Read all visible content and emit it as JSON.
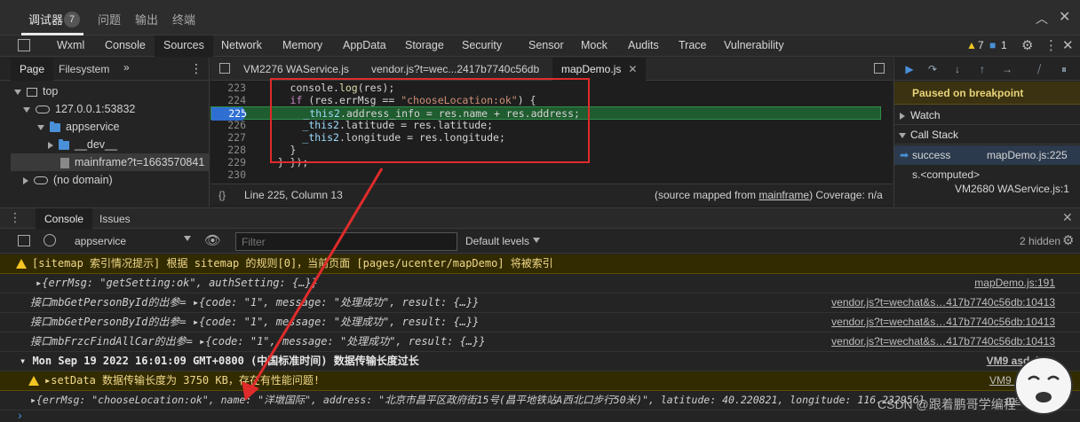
{
  "top_tabs": [
    {
      "label": "调试器",
      "active": true
    },
    {
      "label": "问题"
    },
    {
      "label": "输出"
    },
    {
      "label": "终端"
    }
  ],
  "top_badge": "7",
  "devtools_tabs": [
    "Wxml",
    "Console",
    "Sources",
    "Network",
    "Memory",
    "AppData",
    "Storage",
    "Security",
    "Sensor",
    "Mock",
    "Audits",
    "Trace",
    "Vulnerability"
  ],
  "devtools_active": "Sources",
  "warn_count": "7",
  "info_count": "1",
  "navigator": {
    "tabs": [
      "Page",
      "Filesystem"
    ],
    "more": "»",
    "tree": [
      "top",
      "127.0.0.1:53832",
      "appservice",
      "__dev__",
      "mainframe?t=1663570841",
      "(no domain)"
    ]
  },
  "editor": {
    "tabs": [
      "VM2276 WAService.js",
      "vendor.js?t=wec...2417b7740c56db",
      "mapDemo.js"
    ],
    "lines": [
      {
        "num": "223",
        "text": "      console.log(res);"
      },
      {
        "num": "224",
        "text": "      if (res.errMsg == \"chooseLocation:ok\") {"
      },
      {
        "num": "225",
        "text": "        _this2.address_info = res.name + res.address;"
      },
      {
        "num": "226",
        "text": "        _this2.latitude = res.latitude;"
      },
      {
        "num": "227",
        "text": "        _this2.longitude = res.longitude;"
      },
      {
        "num": "228",
        "text": "      }"
      },
      {
        "num": "229",
        "text": "    } });"
      },
      {
        "num": "230",
        "text": ""
      }
    ],
    "status_pos": "Line 225, Column 13",
    "status_mapped_prefix": "(source mapped from ",
    "status_mapped_link": "mainframe",
    "status_mapped_suffix": ") Coverage: n/a"
  },
  "debugger": {
    "paused": "Paused on breakpoint",
    "watch": "Watch",
    "call_stack": "Call Stack",
    "stack": [
      {
        "fn": "success",
        "loc": "mapDemo.js:225"
      },
      {
        "fn": "s.<computed>",
        "loc": ""
      },
      {
        "fn": "",
        "loc": "VM2680 WAService.js:1"
      }
    ]
  },
  "console": {
    "tabs": [
      "Console",
      "Issues"
    ],
    "context": "appservice",
    "filter_placeholder": "Filter",
    "levels": "Default levels",
    "hidden": "2 hidden",
    "messages": [
      {
        "type": "warn",
        "text": "[sitemap 索引情况提示] 根据 sitemap 的规则[0]，当前页面 [pages/ucenter/mapDemo] 将被索引",
        "src": ""
      },
      {
        "type": "log",
        "text": "▸{errMsg: \"getSetting:ok\", authSetting: {…}}",
        "src": "mapDemo.js:191"
      },
      {
        "type": "log",
        "text": "接口mbGetPersonById的出参= ▸{code: \"1\", message: \"处理成功\", result: {…}}",
        "src": "vendor.js?t=wechat&s…417b7740c56db:10413"
      },
      {
        "type": "log",
        "text": "接口mbGetPersonById的出参= ▸{code: \"1\", message: \"处理成功\", result: {…}}",
        "src": "vendor.js?t=wechat&s…417b7740c56db:10413"
      },
      {
        "type": "log",
        "text": "接口mbFrzcFindAllCar的出参= ▸{code: \"1\", message: \"处理成功\", result: {…}}",
        "src": "vendor.js?t=wechat&s…417b7740c56db:10413"
      },
      {
        "type": "group",
        "text": "▾ Mon Sep 19 2022 16:01:09 GMT+0800 (中国标准时间) 数据传输长度过长",
        "src": "VM9 asdebug"
      },
      {
        "type": "warn",
        "text": "▸setData 数据传输长度为 3750 KB，存在有性能问题!",
        "src": "VM9 asdebug"
      },
      {
        "type": "log",
        "text": "▸{errMsg: \"chooseLocation:ok\", name: \"洋墩国际\", address: \"北京市昌平区政府街15号(昌平地铁站A西北口步行50米)\", latitude: 40.220821, longitude: 116.232956}",
        "src": "mapDemo"
      }
    ],
    "prompt": "›"
  },
  "watermark": "CSDN @跟着鹏哥学编程",
  "colors": {
    "accent": "#2f6fd1",
    "warn_bg": "#332b00",
    "highlight": "#1f5c2f",
    "annotation": "#e02b2b"
  }
}
